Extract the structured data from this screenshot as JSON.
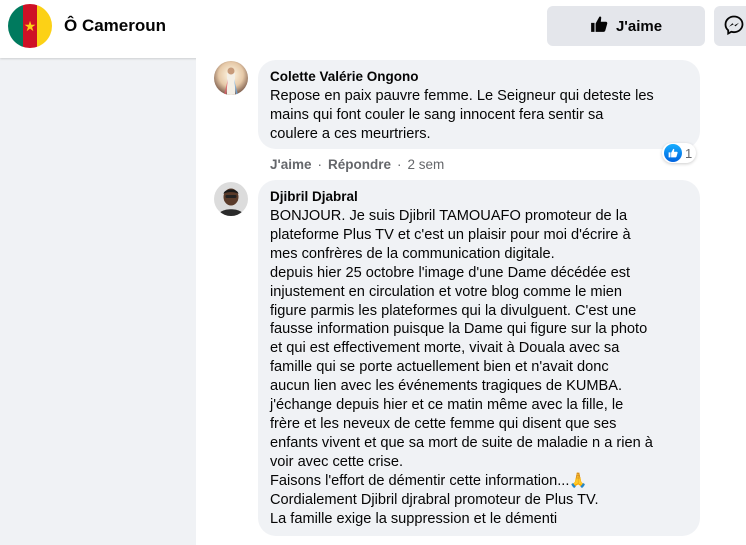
{
  "header": {
    "page_name": "Ô Cameroun",
    "like_label": "J'aime",
    "flag_colors": {
      "green": "#007a5e",
      "red": "#ce1126",
      "yellow": "#fcd116"
    }
  },
  "comments": [
    {
      "author": "Colette Valérie Ongono",
      "text": "Repose en paix pauvre femme. Le Seigneur qui deteste les\nmains qui font couler le sang innocent fera sentir sa\ncoulere a ces meurtriers.",
      "like_label": "J'aime",
      "reply_label": "Répondre",
      "time": "2 sem",
      "reaction_count": "1",
      "separator": "·"
    },
    {
      "author": "Djibril Djabral",
      "text": "BONJOUR. Je suis Djibril TAMOUAFO promoteur de la\nplateforme Plus TV et c'est un plaisir pour moi d'écrire à\nmes confrères de la communication digitale.\ndepuis hier 25 octobre l'image d'une Dame décédée est\ninjustement en circulation et votre blog comme le mien\nfigure parmis les plateformes qui la divulguent. C'est une\nfausse information puisque la Dame qui figure sur la photo\net qui est effectivement morte, vivait à Douala avec sa\nfamille qui se porte actuellement bien et n'avait donc\naucun lien avec les événements tragiques de KUMBA.\nj'échange depuis hier et ce matin même avec la fille, le\nfrère et les neveux de cette femme qui disent que ses\nenfants vivent et que sa mort de suite de maladie n a rien à\nvoir avec cette crise.\nFaisons l'effort de démentir cette information...🙏\nCordialement Djibril djrabral promoteur de Plus TV.\nLa famille exige la suppression et le démenti"
    }
  ],
  "colors": {
    "bubble": "#f0f2f5",
    "secondary_text": "#65676b",
    "like_blue": "#1877f2"
  }
}
